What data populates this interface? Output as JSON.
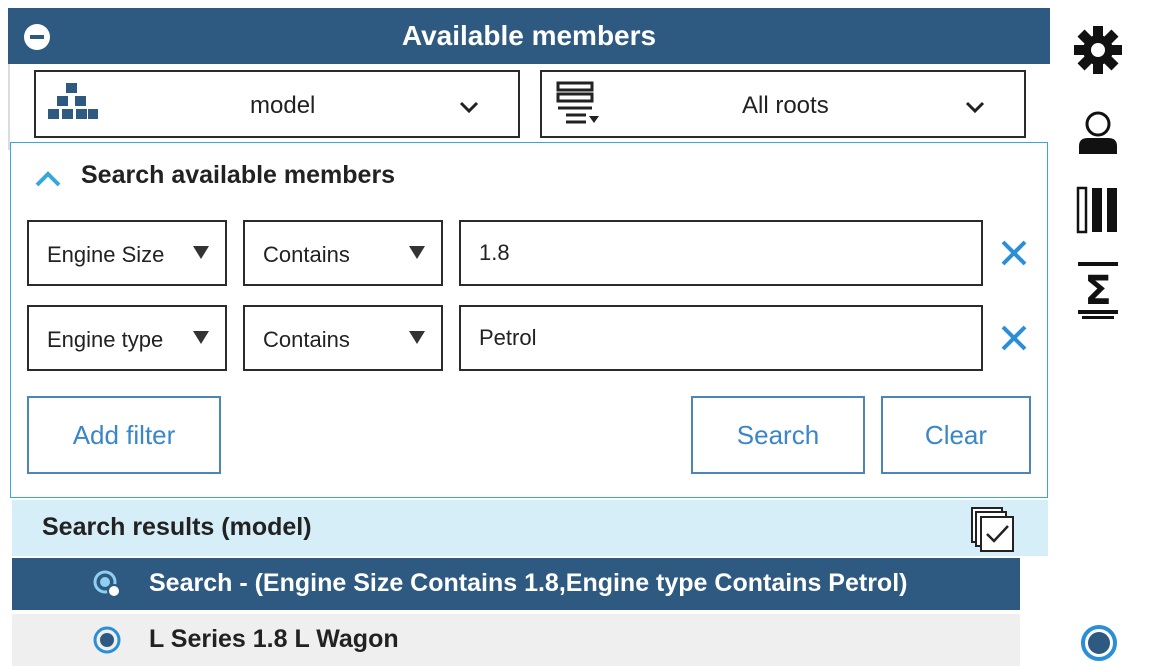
{
  "panel": {
    "title": "Available members"
  },
  "hierarchy_select": {
    "value": "model",
    "icon": "hierarchy-icon"
  },
  "roots_select": {
    "value": "All roots",
    "icon": "filter-list-icon"
  },
  "search": {
    "header": "Search available members",
    "filters": [
      {
        "field": "Engine Size",
        "operator": "Contains",
        "value": "1.8"
      },
      {
        "field": "Engine type",
        "operator": "Contains",
        "value": "Petrol"
      }
    ],
    "add_filter_label": "Add filter",
    "search_label": "Search",
    "clear_label": "Clear"
  },
  "results": {
    "header": "Search results (model)",
    "rows": [
      {
        "label": "Search - (Engine Size Contains 1.8,Engine type Contains Petrol)",
        "selected": true,
        "icon": "search-result-icon"
      },
      {
        "label": "L Series 1.8 L Wagon",
        "selected": false,
        "icon": "radio-member-icon"
      }
    ]
  },
  "sidebar": {
    "icons": [
      "gear-icon",
      "user-icon",
      "columns-icon",
      "sum-icon",
      "status-circle-icon"
    ]
  },
  "colors": {
    "title_bar": "#2e5a82",
    "accent": "#37a7dc",
    "button_text": "#3a86c8",
    "results_header": "#d6eef8"
  }
}
